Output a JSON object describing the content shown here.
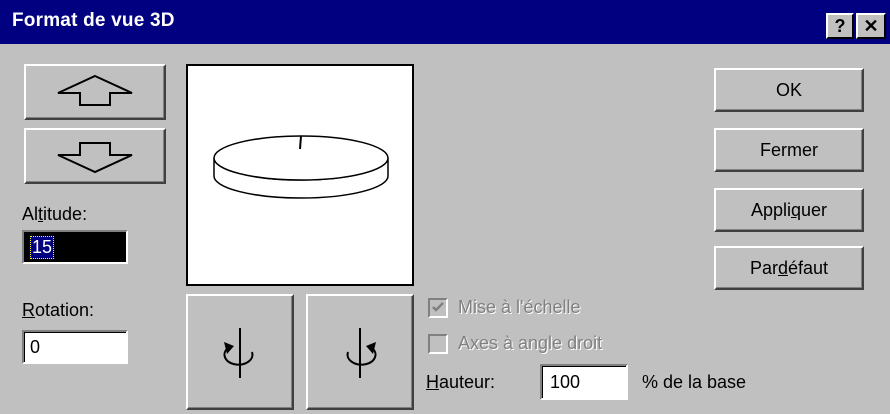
{
  "window": {
    "title": "Format de vue 3D",
    "help_label": "?",
    "close_label": "✕"
  },
  "elevation": {
    "label_before": "Al",
    "label_accel": "t",
    "label_after": "itude:",
    "value": "15"
  },
  "rotation": {
    "label_accel": "R",
    "label_after": "otation:",
    "value": "0"
  },
  "buttons": {
    "ok": "OK",
    "close": "Fermer",
    "apply_before": "Appli",
    "apply_accel": "q",
    "apply_after": "uer",
    "default_before": "Par ",
    "default_accel": "d",
    "default_after": "éfaut"
  },
  "options": {
    "scale_label": "Mise à l'échelle",
    "scale_checked": true,
    "right_angle_label": "Axes à angle droit",
    "right_angle_checked": false
  },
  "height": {
    "label_accel": "H",
    "label_after": "auteur:",
    "value": "100",
    "unit": "% de la base"
  }
}
